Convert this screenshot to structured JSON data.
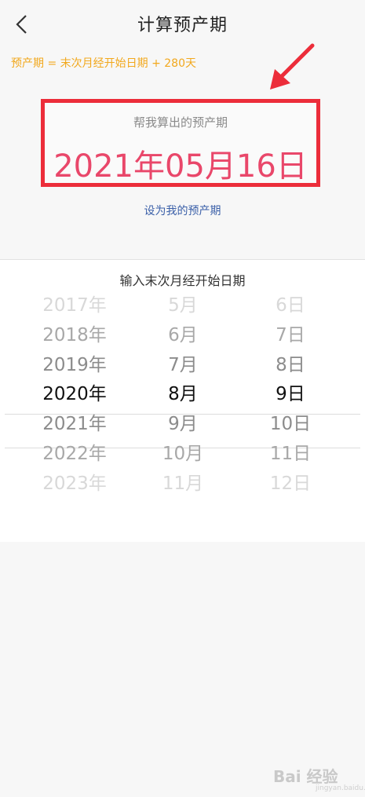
{
  "header": {
    "title": "计算预产期",
    "back_icon": "chevron-left-icon"
  },
  "formula": "预产期 = 末次月经开始日期 + 280天",
  "result": {
    "caption": "帮我算出的预产期",
    "date": "2021年05月16日"
  },
  "set_link": "设为我的预产期",
  "picker": {
    "title": "输入末次月经开始日期",
    "years": [
      "2017年",
      "2018年",
      "2019年",
      "2020年",
      "2021年",
      "2022年",
      "2023年"
    ],
    "months": [
      "5月",
      "6月",
      "7月",
      "8月",
      "9月",
      "10月",
      "11月"
    ],
    "days": [
      "6日",
      "7日",
      "8日",
      "9日",
      "10日",
      "11日",
      "12日"
    ],
    "selected_index": 3
  },
  "watermark": {
    "brand": "Bai 经验",
    "url": "jingyan.baidu.com"
  },
  "colors": {
    "formula": "#f2a81d",
    "result_date": "#e9476a",
    "highlight_box": "#ec2d3a",
    "annotation_arrow": "#ec2d3a",
    "link": "#3a5fa8"
  }
}
